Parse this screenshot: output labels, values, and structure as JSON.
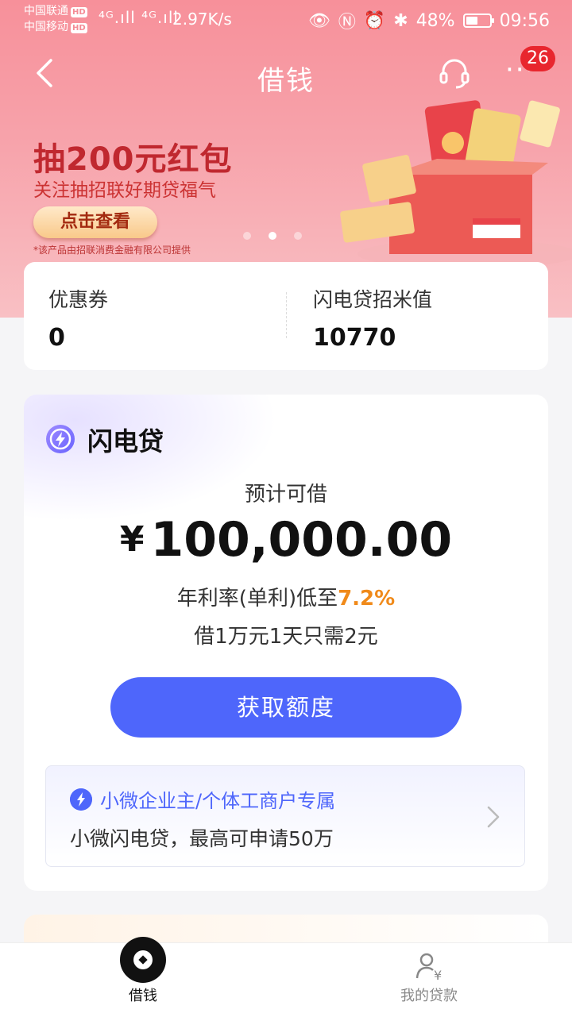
{
  "status_bar": {
    "carrier1": "中国联通",
    "carrier2": "中国移动",
    "hd": "HD",
    "network": "⁴ᴳ.ıll ⁴ᴳ.ıll",
    "speed": "2.97K/s",
    "battery": "48%",
    "time": "09:56"
  },
  "nav": {
    "title": "借钱",
    "notification_count": "26",
    "more": "···"
  },
  "banner": {
    "title": "抽200元红包",
    "subtitle": "关注抽招联好期贷福气",
    "button_label": "点击查看",
    "disclaimer": "*该产品由招联消费金融有限公司提供"
  },
  "info": {
    "coupon_label": "优惠券",
    "coupon_value": "0",
    "score_label": "闪电贷招米值",
    "score_value": "10770"
  },
  "loan": {
    "name": "闪电贷",
    "estimate_label": "预计可借",
    "currency": "¥",
    "amount": "100,000.00",
    "rate_prefix": "年利率(单利)低至",
    "rate": "7.2%",
    "cost_line": "借1万元1天只需2元",
    "cta_label": "获取额度",
    "promo_title": "小微企业主/个体工商户专属",
    "promo_subtitle": "小微闪电贷，最高可申请50万"
  },
  "tabs": {
    "borrow": "借钱",
    "my_loans": "我的贷款"
  },
  "colors": {
    "accent": "#4e66fb",
    "rate": "#f08a1a",
    "header": "#f7909a"
  }
}
